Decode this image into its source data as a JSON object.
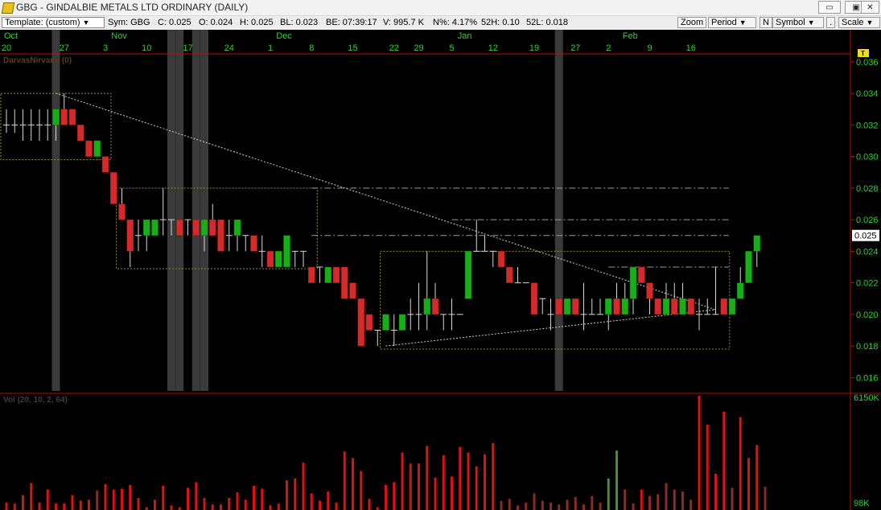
{
  "window": {
    "title": "GBG - GINDALBIE METALS LTD  ORDINARY (DAILY)",
    "min_label": "▭",
    "max_label": "▣",
    "close_label": "✕"
  },
  "toolbar": {
    "template": "Template: (custom)",
    "sym": "Sym: GBG",
    "close": "C: 0.025",
    "open": "O: 0.024",
    "high": "H: 0.025",
    "bl": "BL: 0.023",
    "be": "BE: 07:39:17",
    "volume": "V: 995.7 K",
    "npct": "N%: 4.17%",
    "h52": "52H: 0.10",
    "l52": "52L: 0.018",
    "zoom": "Zoom",
    "period": "Period",
    "n": "N",
    "symbol": "Symbol",
    "dot": ".",
    "scale": "Scale"
  },
  "colors": {
    "up": "#16b016",
    "down": "#d42a2a",
    "background": "#000000",
    "axis_text": "#33cc33",
    "current_price_bg": "#ffffff",
    "volume_bar": "#e01010",
    "volume_bar_dim": "#8c2a2a",
    "volume_bar_green": "#4a8a3a",
    "box_lines": "#8f8f2a",
    "trend_lines": "#cfcfcf",
    "grey_bands": "#3a3a3a"
  },
  "chart_data": {
    "type": "candlestick",
    "title": "DarvasNirvana (0)",
    "months": [
      {
        "label": "Oct",
        "index": 0
      },
      {
        "label": "Nov",
        "index": 13
      },
      {
        "label": "Dec",
        "index": 33
      },
      {
        "label": "Jan",
        "index": 55
      },
      {
        "label": "Feb",
        "index": 75
      }
    ],
    "day_ticks": [
      {
        "label": "20",
        "index": 0
      },
      {
        "label": "27",
        "index": 7
      },
      {
        "label": "3",
        "index": 12
      },
      {
        "label": "10",
        "index": 17
      },
      {
        "label": "17",
        "index": 22
      },
      {
        "label": "24",
        "index": 27
      },
      {
        "label": "1",
        "index": 32
      },
      {
        "label": "8",
        "index": 37
      },
      {
        "label": "15",
        "index": 42
      },
      {
        "label": "22",
        "index": 47
      },
      {
        "label": "29",
        "index": 50
      },
      {
        "label": "5",
        "index": 54
      },
      {
        "label": "12",
        "index": 59
      },
      {
        "label": "19",
        "index": 64
      },
      {
        "label": "27",
        "index": 69
      },
      {
        "label": "2",
        "index": 73
      },
      {
        "label": "9",
        "index": 78
      },
      {
        "label": "16",
        "index": 83
      }
    ],
    "price_axis": {
      "min": 0.015,
      "max": 0.0365,
      "ticks": [
        "0.036",
        "0.034",
        "0.032",
        "0.030",
        "0.028",
        "0.026",
        "0.024",
        "0.022",
        "0.020",
        "0.018",
        "0.016"
      ],
      "tick_values": [
        0.036,
        0.034,
        0.032,
        0.03,
        0.028,
        0.026,
        0.024,
        0.022,
        0.02,
        0.018,
        0.016
      ],
      "current_price_label": "0.025",
      "current_price": 0.025,
      "t_marker": "T"
    },
    "candles": [
      [
        0.032,
        0.033,
        0.0315,
        0.032
      ],
      [
        0.032,
        0.033,
        0.0315,
        0.032
      ],
      [
        0.032,
        0.033,
        0.031,
        0.032
      ],
      [
        0.032,
        0.033,
        0.031,
        0.032
      ],
      [
        0.032,
        0.033,
        0.031,
        0.032
      ],
      [
        0.032,
        0.033,
        0.031,
        0.032
      ],
      [
        0.032,
        0.033,
        0.031,
        0.033
      ],
      [
        0.033,
        0.034,
        0.032,
        0.032
      ],
      [
        0.033,
        0.033,
        0.032,
        0.032
      ],
      [
        0.032,
        0.032,
        0.031,
        0.031
      ],
      [
        0.031,
        0.031,
        0.03,
        0.03
      ],
      [
        0.03,
        0.031,
        0.03,
        0.031
      ],
      [
        0.03,
        0.03,
        0.029,
        0.029
      ],
      [
        0.029,
        0.029,
        0.027,
        0.027
      ],
      [
        0.027,
        0.028,
        0.026,
        0.026
      ],
      [
        0.026,
        0.026,
        0.023,
        0.024
      ],
      [
        0.025,
        0.026,
        0.024,
        0.025
      ],
      [
        0.025,
        0.026,
        0.024,
        0.026
      ],
      [
        0.025,
        0.026,
        0.025,
        0.026
      ],
      [
        0.026,
        0.028,
        0.025,
        0.026
      ],
      [
        0.026,
        0.026,
        0.025,
        0.026
      ],
      [
        0.026,
        0.026,
        0.025,
        0.025
      ],
      [
        0.026,
        0.026,
        0.025,
        0.026
      ],
      [
        0.026,
        0.026,
        0.025,
        0.025
      ],
      [
        0.025,
        0.026,
        0.024,
        0.026
      ],
      [
        0.026,
        0.027,
        0.025,
        0.025
      ],
      [
        0.026,
        0.026,
        0.024,
        0.024
      ],
      [
        0.025,
        0.026,
        0.024,
        0.025
      ],
      [
        0.025,
        0.026,
        0.024,
        0.026
      ],
      [
        0.025,
        0.025,
        0.024,
        0.025
      ],
      [
        0.025,
        0.025,
        0.024,
        0.024
      ],
      [
        0.024,
        0.025,
        0.023,
        0.024
      ],
      [
        0.024,
        0.024,
        0.023,
        0.023
      ],
      [
        0.023,
        0.024,
        0.023,
        0.024
      ],
      [
        0.023,
        0.025,
        0.023,
        0.025
      ],
      [
        0.024,
        0.024,
        0.023,
        0.024
      ],
      [
        0.024,
        0.024,
        0.023,
        0.024
      ],
      [
        0.023,
        0.023,
        0.022,
        0.022
      ],
      [
        0.023,
        0.023,
        0.022,
        0.023
      ],
      [
        0.022,
        0.023,
        0.022,
        0.023
      ],
      [
        0.023,
        0.023,
        0.022,
        0.022
      ],
      [
        0.023,
        0.023,
        0.021,
        0.021
      ],
      [
        0.022,
        0.022,
        0.021,
        0.021
      ],
      [
        0.021,
        0.021,
        0.018,
        0.018
      ],
      [
        0.02,
        0.02,
        0.019,
        0.019
      ],
      [
        0.019,
        0.019,
        0.018,
        0.019
      ],
      [
        0.019,
        0.02,
        0.019,
        0.02
      ],
      [
        0.019,
        0.02,
        0.018,
        0.019
      ],
      [
        0.019,
        0.02,
        0.019,
        0.02
      ],
      [
        0.02,
        0.021,
        0.019,
        0.02
      ],
      [
        0.02,
        0.022,
        0.019,
        0.02
      ],
      [
        0.02,
        0.024,
        0.019,
        0.021
      ],
      [
        0.021,
        0.022,
        0.02,
        0.02
      ],
      [
        0.02,
        0.02,
        0.019,
        0.02
      ],
      [
        0.02,
        0.021,
        0.019,
        0.02
      ],
      [
        0.02,
        0.02,
        0.02,
        0.02
      ],
      [
        0.021,
        0.024,
        0.021,
        0.024
      ],
      [
        0.024,
        0.026,
        0.024,
        0.024
      ],
      [
        0.024,
        0.025,
        0.024,
        0.024
      ],
      [
        0.024,
        0.024,
        0.023,
        0.024
      ],
      [
        0.024,
        0.024,
        0.023,
        0.023
      ],
      [
        0.023,
        0.023,
        0.022,
        0.022
      ],
      [
        0.022,
        0.023,
        0.022,
        0.022
      ],
      [
        0.022,
        0.022,
        0.022,
        0.022
      ],
      [
        0.022,
        0.022,
        0.02,
        0.02
      ],
      [
        0.021,
        0.021,
        0.02,
        0.021
      ],
      [
        0.02,
        0.021,
        0.019,
        0.02
      ],
      [
        0.021,
        0.021,
        0.02,
        0.02
      ],
      [
        0.02,
        0.021,
        0.02,
        0.021
      ],
      [
        0.021,
        0.021,
        0.02,
        0.02
      ],
      [
        0.02,
        0.022,
        0.019,
        0.02
      ],
      [
        0.02,
        0.021,
        0.02,
        0.02
      ],
      [
        0.02,
        0.021,
        0.02,
        0.02
      ],
      [
        0.02,
        0.021,
        0.019,
        0.021
      ],
      [
        0.021,
        0.022,
        0.02,
        0.02
      ],
      [
        0.02,
        0.022,
        0.02,
        0.021
      ],
      [
        0.021,
        0.023,
        0.02,
        0.023
      ],
      [
        0.023,
        0.023,
        0.022,
        0.022
      ],
      [
        0.022,
        0.022,
        0.02,
        0.021
      ],
      [
        0.021,
        0.021,
        0.02,
        0.02
      ],
      [
        0.02,
        0.022,
        0.02,
        0.021
      ],
      [
        0.021,
        0.022,
        0.02,
        0.02
      ],
      [
        0.02,
        0.022,
        0.02,
        0.021
      ],
      [
        0.021,
        0.021,
        0.02,
        0.02
      ],
      [
        0.02,
        0.021,
        0.019,
        0.02
      ],
      [
        0.02,
        0.021,
        0.02,
        0.02
      ],
      [
        0.02,
        0.023,
        0.02,
        0.02
      ],
      [
        0.021,
        0.021,
        0.02,
        0.02
      ],
      [
        0.02,
        0.021,
        0.02,
        0.021
      ],
      [
        0.021,
        0.023,
        0.021,
        0.022
      ],
      [
        0.022,
        0.024,
        0.022,
        0.024
      ],
      [
        0.024,
        0.025,
        0.023,
        0.025
      ]
    ],
    "darvas_boxes": [
      {
        "start": 0,
        "end": 12,
        "top": 0.034,
        "bottom": 0.0298
      },
      {
        "start": 14,
        "end": 37,
        "top": 0.028,
        "bottom": 0.0229
      },
      {
        "start": 46,
        "end": 87,
        "top": 0.024,
        "bottom": 0.0178
      }
    ],
    "resistance_lines": [
      {
        "start": 37,
        "end": 87,
        "value": 0.028
      },
      {
        "start": 54,
        "end": 87,
        "value": 0.026
      },
      {
        "start": 37,
        "end": 87,
        "value": 0.025
      },
      {
        "start": 73,
        "end": 87,
        "value": 0.023
      }
    ],
    "trend_lines": [
      {
        "from": [
          6,
          0.034
        ],
        "to": [
          86,
          0.0203
        ]
      },
      {
        "from": [
          46,
          0.018
        ],
        "to": [
          86,
          0.0203
        ]
      }
    ],
    "grey_band_indices": [
      6,
      20,
      21,
      23,
      24,
      67
    ],
    "volume": {
      "label": "Vol (20, 10, 2, 64)",
      "axis_top": "6150K",
      "axis_bottom": "98K",
      "max_k": 6150,
      "values_k": [
        400,
        350,
        800,
        1450,
        400,
        1100,
        350,
        350,
        800,
        500,
        550,
        1050,
        1400,
        1100,
        1150,
        1350,
        650,
        150,
        550,
        1300,
        250,
        150,
        1200,
        1500,
        650,
        300,
        300,
        650,
        950,
        550,
        1300,
        1150,
        250,
        350,
        1600,
        1700,
        2550,
        900,
        500,
        1000,
        400,
        3150,
        2800,
        2100,
        600,
        150,
        1350,
        1500,
        3100,
        2500,
        2500,
        3450,
        1750,
        2950,
        1800,
        3400,
        3100,
        2350,
        3000,
        3600,
        500,
        600,
        250,
        400,
        900,
        500,
        400,
        300,
        550,
        700,
        300,
        750,
        400,
        1700,
        3200,
        1100,
        350,
        1100,
        750,
        850,
        1450,
        1100,
        1000,
        550,
        6150,
        4600,
        1950,
        5300,
        1200,
        5000,
        2800,
        3500,
        1250
      ],
      "colors": [
        "r",
        "r",
        "r",
        "r",
        "r",
        "r",
        "r",
        "r",
        "r",
        "r",
        "r",
        "d",
        "r",
        "r",
        "r",
        "r",
        "r",
        "r",
        "r",
        "r",
        "r",
        "r",
        "r",
        "r",
        "r",
        "r",
        "r",
        "r",
        "r",
        "r",
        "r",
        "r",
        "r",
        "r",
        "r",
        "r",
        "r",
        "r",
        "r",
        "r",
        "r",
        "r",
        "r",
        "r",
        "r",
        "r",
        "r",
        "r",
        "r",
        "r",
        "r",
        "r",
        "r",
        "r",
        "r",
        "r",
        "r",
        "r",
        "r",
        "r",
        "d",
        "d",
        "d",
        "d",
        "d",
        "d",
        "d",
        "d",
        "d",
        "d",
        "d",
        "d",
        "d",
        "g",
        "g",
        "d",
        "d",
        "r",
        "d",
        "d",
        "d",
        "d",
        "d",
        "d",
        "r",
        "r",
        "r",
        "r",
        "d",
        "r",
        "r",
        "r",
        "d"
      ]
    }
  }
}
